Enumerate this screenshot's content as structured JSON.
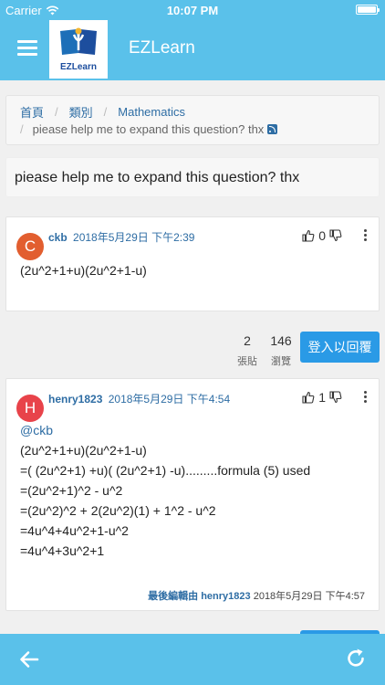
{
  "status_bar": {
    "carrier": "Carrier",
    "time": "10:07 PM",
    "battery_level": 1.0
  },
  "header": {
    "title": "EZLearn",
    "logo_text": "EZLearn"
  },
  "breadcrumb": {
    "items": [
      "首頁",
      "類別",
      "Mathematics"
    ],
    "current": "piease help me to expand this question? thx"
  },
  "topic": {
    "title": "piease help me to expand this question? thx"
  },
  "posts": [
    {
      "avatar_letter": "C",
      "avatar_color": "#e25e2f",
      "username": "ckb",
      "timestamp": "2018年5月29日 下午2:39",
      "votes": "0",
      "body": [
        "(2u^2+1+u)(2u^2+1-u)"
      ]
    },
    {
      "avatar_letter": "H",
      "avatar_color": "#e8434a",
      "username": "henry1823",
      "timestamp": "2018年5月29日 下午4:54",
      "votes": "1",
      "mention": "@ckb",
      "body": [
        "(2u^2+1+u)(2u^2+1-u)",
        "=( (2u^2+1) +u)( (2u^2+1) -u).........formula (5) used",
        "=(2u^2+1)^2 - u^2",
        "=(2u^2)^2 + 2(2u^2)(1) + 1^2 - u^2",
        "=4u^4+4u^2+1-u^2",
        "=4u^4+3u^2+1"
      ],
      "edited_label": "最後編輯由",
      "edited_by": "henry1823",
      "edited_time": "2018年5月29日 下午4:57"
    }
  ],
  "stats": {
    "posts_count": "2",
    "posts_label": "張貼",
    "views_count": "146",
    "views_label": "瀏覽"
  },
  "reply_button": "登入以回覆",
  "colors": {
    "header": "#5ac1ea",
    "link": "#2e6da4",
    "button": "#2a9ae6"
  },
  "icons": {
    "menu": "menu-icon",
    "back": "arrow-left-icon",
    "refresh": "refresh-icon",
    "rss": "rss-icon",
    "upvote": "thumbs-up-icon",
    "downvote": "thumbs-down-icon",
    "more": "more-vertical-icon",
    "wifi": "wifi-icon"
  }
}
